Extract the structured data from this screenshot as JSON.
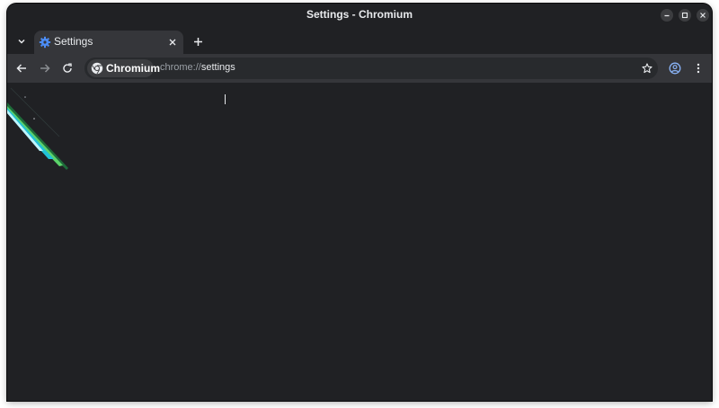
{
  "window": {
    "title": "Settings - Chromium"
  },
  "tabs": [
    {
      "title": "Settings",
      "icon": "gear-icon",
      "active": true
    }
  ],
  "omnibox": {
    "chip_label": "Chromium",
    "url_scheme": "chrome://",
    "url_path": "settings"
  },
  "colors": {
    "window_bg": "#202124",
    "toolbar_bg": "#35363a",
    "accent": "#4c8df6",
    "text": "#e8eaed"
  }
}
